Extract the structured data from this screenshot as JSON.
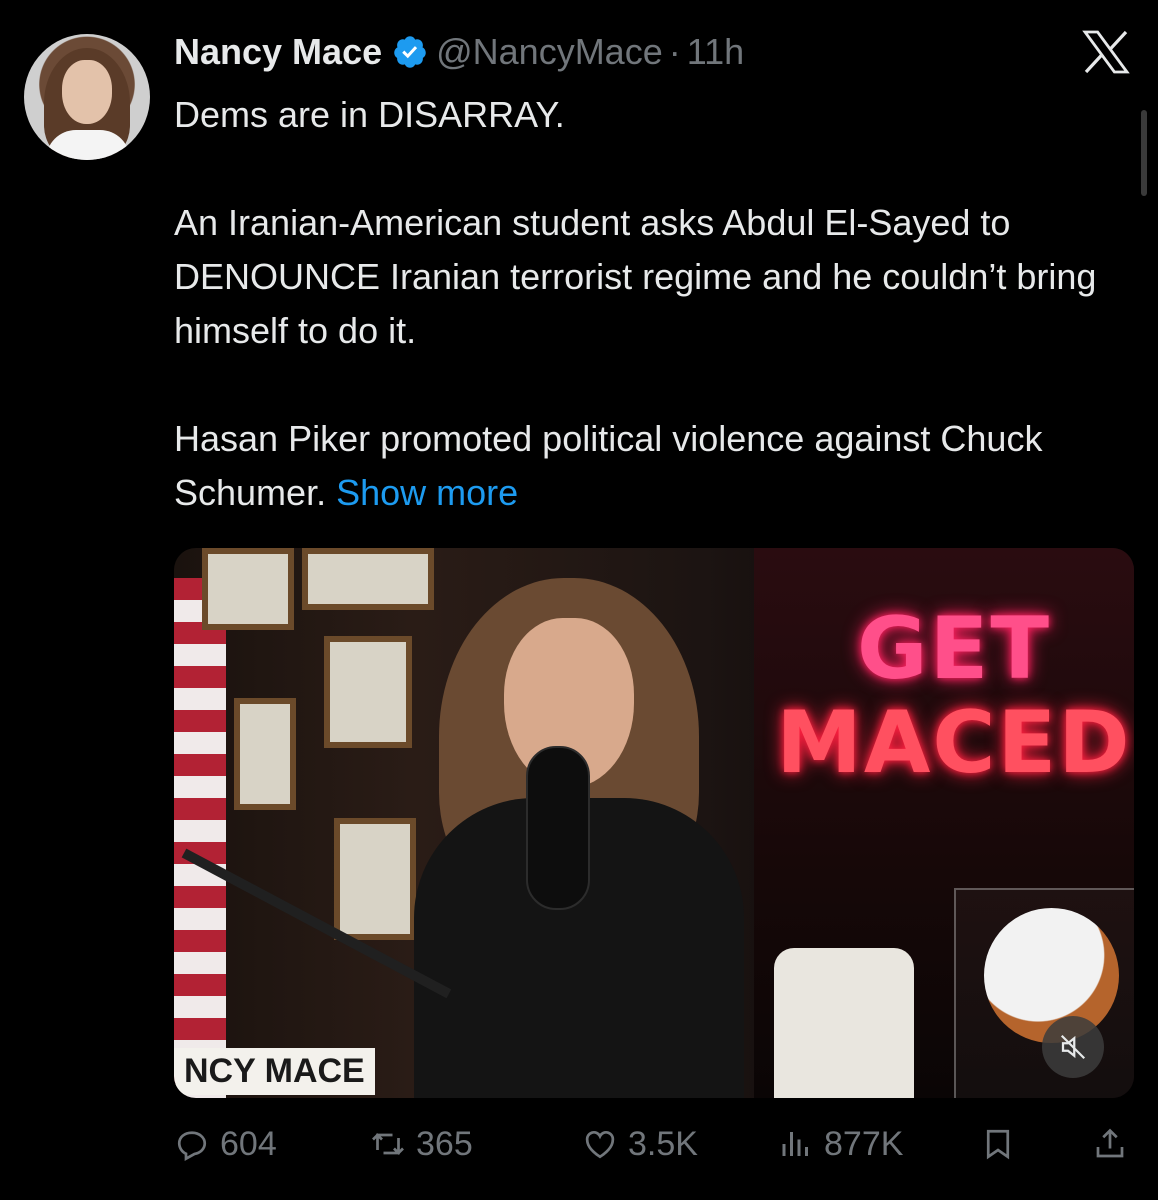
{
  "author": {
    "name": "Nancy Mace",
    "handle": "@NancyMace",
    "separator": "·",
    "time": "11h",
    "verified_color": "#1d9bf0"
  },
  "tweet": {
    "p1": "Dems are in DISARRAY.",
    "p2": "An Iranian-American student asks Abdul El-Sayed to DENOUNCE Iranian terrorist regime and he couldn’t bring himself to do it.",
    "p3": "Hasan Piker promoted political violence against Chuck Schumer.",
    "show_more": "Show more"
  },
  "media": {
    "neon_line1": "GET",
    "neon_line2": "MACED",
    "lower_third": "NCY MACE",
    "mute_icon": "volume-muted-icon"
  },
  "actions": {
    "replies": "604",
    "reposts": "365",
    "likes": "3.5K",
    "views": "877K"
  },
  "colors": {
    "background": "#000000",
    "text": "#e7e9ea",
    "muted": "#71767b",
    "link": "#1d9bf0"
  }
}
